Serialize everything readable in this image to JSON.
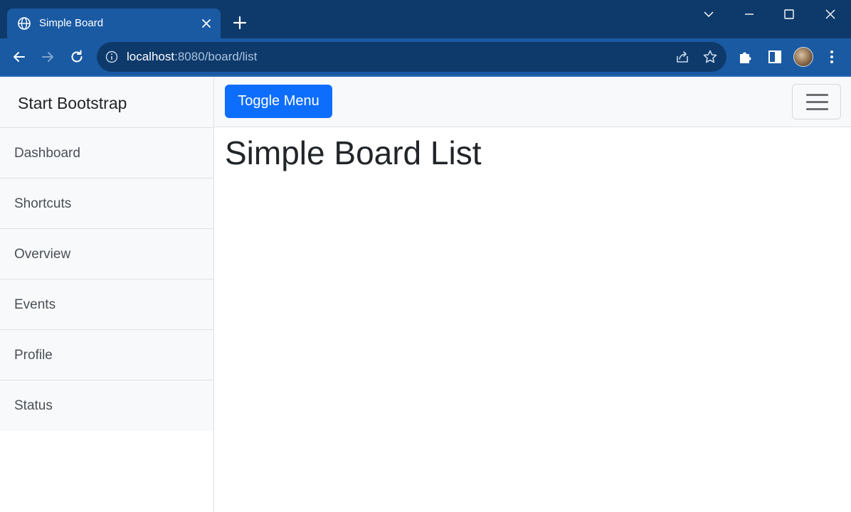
{
  "browser": {
    "tab": {
      "title": "Simple Board"
    },
    "address_bar": {
      "host": "localhost",
      "path": ":8080/board/list"
    }
  },
  "sidebar": {
    "heading": "Start Bootstrap",
    "items": [
      {
        "label": "Dashboard"
      },
      {
        "label": "Shortcuts"
      },
      {
        "label": "Overview"
      },
      {
        "label": "Events"
      },
      {
        "label": "Profile"
      },
      {
        "label": "Status"
      }
    ]
  },
  "navbar": {
    "toggle_label": "Toggle Menu"
  },
  "main": {
    "title": "Simple Board List"
  },
  "colors": {
    "primary": "#0d6efd",
    "chrome_dark": "#0e3a6b",
    "chrome_tab": "#1a5aa3",
    "sidebar_bg": "#f8f9fa"
  }
}
